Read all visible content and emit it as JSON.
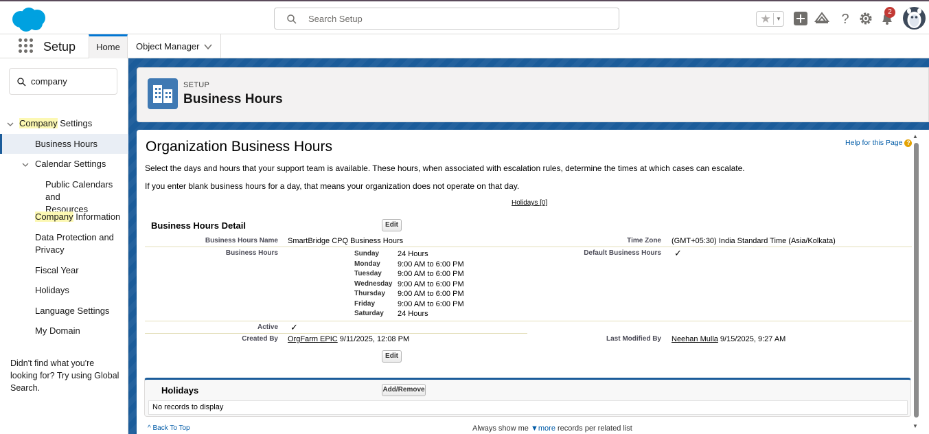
{
  "topbar": {
    "search_placeholder": "Search Setup",
    "notification_count": "2"
  },
  "navbar": {
    "app_title": "Setup",
    "tabs": [
      {
        "label": "Home"
      },
      {
        "label": "Object Manager"
      }
    ]
  },
  "sidebar": {
    "quick_find_value": "company",
    "items": {
      "company_settings_hl": "Company",
      "company_settings_rest": " Settings",
      "business_hours": "Business Hours",
      "calendar_settings": "Calendar Settings",
      "public_calendars_1": "Public Calendars and",
      "public_calendars_2": "Resources",
      "company_info_hl": "Company",
      "company_info_rest": " Information",
      "data_protection_1": "Data Protection and",
      "data_protection_2": "Privacy",
      "fiscal_year": "Fiscal Year",
      "holidays": "Holidays",
      "language_settings": "Language Settings",
      "my_domain": "My Domain"
    },
    "footer_1": "Didn't find what you're",
    "footer_2": "looking for? Try using Global",
    "footer_3": "Search."
  },
  "header": {
    "eyebrow": "SETUP",
    "title": "Business Hours"
  },
  "content": {
    "title": "Organization Business Hours",
    "help_link": "Help for this Page",
    "para1": "Select the days and hours that your support team is available. These hours, when associated with escalation rules, determine the times at which cases can escalate.",
    "para2": "If you enter blank business hours for a day, that means your organization does not operate on that day.",
    "holidays_link": "Holidays [0]",
    "detail": {
      "section_title": "Business Hours Detail",
      "edit_label": "Edit",
      "name_label": "Business Hours Name",
      "name_value": "SmartBridge CPQ Business Hours",
      "timezone_label": "Time Zone",
      "timezone_value": "(GMT+05:30) India Standard Time (Asia/Kolkata)",
      "hours_label": "Business Hours",
      "default_label": "Default Business Hours",
      "default_value": "✓",
      "schedule": [
        {
          "day": "Sunday",
          "hours": "24 Hours"
        },
        {
          "day": "Monday",
          "hours": "9:00 AM to 6:00 PM"
        },
        {
          "day": "Tuesday",
          "hours": "9:00 AM to 6:00 PM"
        },
        {
          "day": "Wednesday",
          "hours": "9:00 AM to 6:00 PM"
        },
        {
          "day": "Thursday",
          "hours": "9:00 AM to 6:00 PM"
        },
        {
          "day": "Friday",
          "hours": "9:00 AM to 6:00 PM"
        },
        {
          "day": "Saturday",
          "hours": "24 Hours"
        }
      ],
      "active_label": "Active",
      "active_value": "✓",
      "created_label": "Created By",
      "created_user": "OrgFarm EPIC",
      "created_date": " 9/11/2025, 12:08 PM",
      "modified_label": "Last Modified By",
      "modified_user": "Neehan Mulla",
      "modified_date": " 9/15/2025, 9:27 AM"
    },
    "holidays_section": {
      "title": "Holidays",
      "add_remove_label": "Add/Remove",
      "empty_text": "No records to display"
    },
    "back_to_top": "Back To Top",
    "always_show_prefix": "Always show me ",
    "always_show_more": "more",
    "always_show_suffix": " records per related list"
  },
  "colors": {
    "brand_blue": "#0176d3",
    "band_blue": "#1b5c9a",
    "header_icon": "#3f79b3",
    "badge_red": "#c23934"
  }
}
